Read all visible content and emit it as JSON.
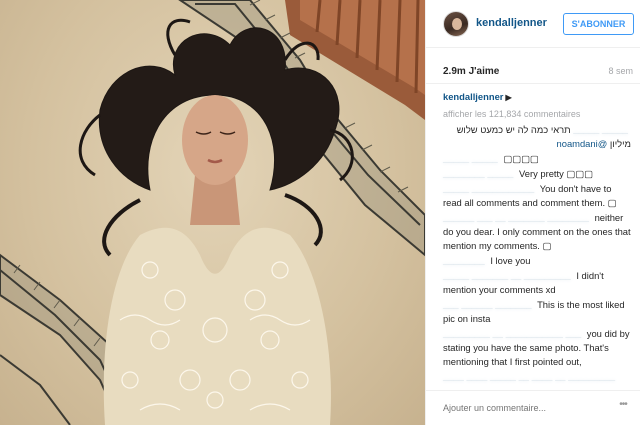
{
  "header": {
    "username": "kendalljenner",
    "follow_label": "S'ABONNER"
  },
  "post": {
    "likes": "2.9m J'aime",
    "time": "8 sem",
    "caption_user": "kendalljenner",
    "caption_symbol": "▶",
    "load_more": "afficher les 121,834 commentaires"
  },
  "comments": [
    {
      "user": "_____ _____",
      "text": "תראי כמה לה יש כמעט שלוש מיליון",
      "mention": "@noamdani",
      "rtl": true
    },
    {
      "user": "_____ _____",
      "text": "▢▢▢▢"
    },
    {
      "user": "________ _____",
      "text": "Very pretty ▢▢▢"
    },
    {
      "user": "_____ ____________",
      "text": "You don't have to read all comments and comment them. ▢"
    },
    {
      "user": "______ ___ __ _______ ________",
      "text": "neither do you dear. I only comment on the ones that mention my comments. ▢"
    },
    {
      "user": "________",
      "text": "I love you"
    },
    {
      "user": "_____ _______ __ _________",
      "text": "I didn't mention your comments xd"
    },
    {
      "user": "___ ______ _______",
      "text": "This is the most liked pic on insta"
    },
    {
      "user": "_________ __ ___________ ___",
      "text": "you did by stating you have the same photo. That's mentioning that I first pointed out,"
    },
    {
      "user": "____ ____ _____ __ ____ __ _________",
      "text": ""
    }
  ],
  "footer": {
    "add_comment_placeholder": "Ajouter un commentaire...",
    "more_label": "•••"
  },
  "icons": {
    "follow": "none",
    "more": "ellipsis-icon"
  },
  "colors": {
    "link_blue": "#125688",
    "button_blue": "#3f9af6",
    "muted_gray": "#a5a7aa"
  }
}
